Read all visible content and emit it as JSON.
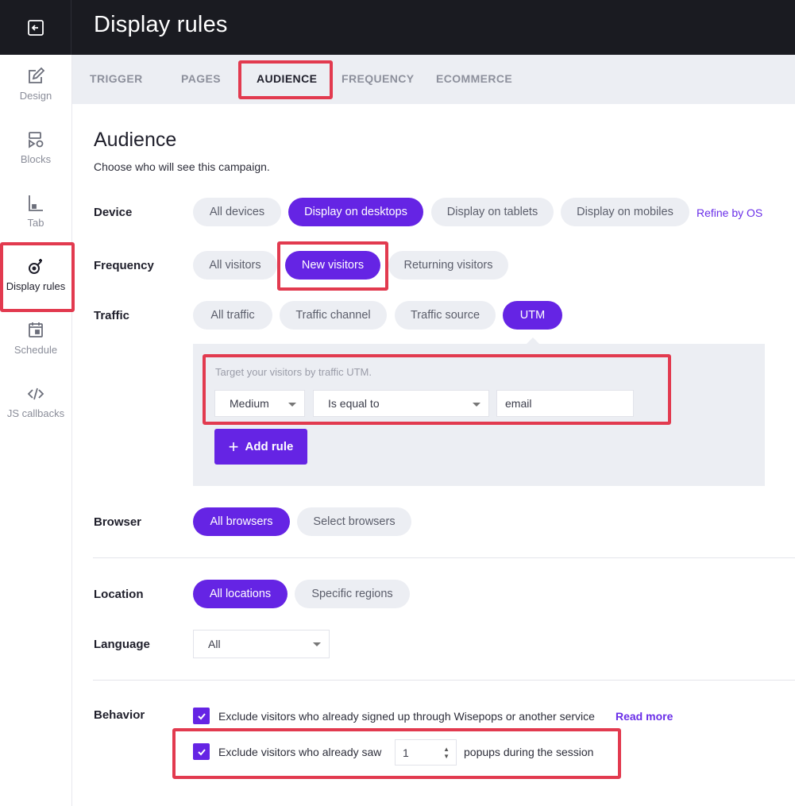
{
  "header": {
    "title": "Display rules",
    "back_icon": "collapse-sidebar-icon"
  },
  "sidebar": {
    "items": [
      {
        "label": "Design",
        "icon": "pencil-square-icon"
      },
      {
        "label": "Blocks",
        "icon": "shapes-icon"
      },
      {
        "label": "Tab",
        "icon": "tab-chart-icon"
      },
      {
        "label": "Display rules",
        "icon": "target-sparkle-icon",
        "active": true
      },
      {
        "label": "Schedule",
        "icon": "calendar-icon"
      },
      {
        "label": "JS callbacks",
        "icon": "code-icon"
      }
    ]
  },
  "tabs": [
    {
      "label": "TRIGGER"
    },
    {
      "label": "PAGES"
    },
    {
      "label": "AUDIENCE",
      "active": true
    },
    {
      "label": "FREQUENCY"
    },
    {
      "label": "ECOMMERCE"
    }
  ],
  "audience": {
    "title": "Audience",
    "subtitle": "Choose who will see this campaign.",
    "device": {
      "label": "Device",
      "options": [
        "All devices",
        "Display on desktops",
        "Display on tablets",
        "Display on mobiles"
      ],
      "selected": "Display on desktops",
      "refine_link": "Refine by OS"
    },
    "frequency": {
      "label": "Frequency",
      "options": [
        "All visitors",
        "New visitors",
        "Returning visitors"
      ],
      "selected": "New visitors"
    },
    "traffic": {
      "label": "Traffic",
      "options": [
        "All traffic",
        "Traffic channel",
        "Traffic source",
        "UTM"
      ],
      "selected": "UTM",
      "utm": {
        "hint": "Target your visitors by traffic UTM.",
        "param": "Medium",
        "operator": "Is equal to",
        "value": "email",
        "add_rule": "Add rule"
      }
    },
    "browser": {
      "label": "Browser",
      "options": [
        "All browsers",
        "Select browsers"
      ],
      "selected": "All browsers"
    },
    "location": {
      "label": "Location",
      "options": [
        "All locations",
        "Specific regions"
      ],
      "selected": "All locations"
    },
    "language": {
      "label": "Language",
      "value": "All"
    },
    "behavior": {
      "label": "Behavior",
      "exclude_signed_up": {
        "text": "Exclude visitors who already signed up through Wisepops or another service",
        "checked": true,
        "read_more": "Read more"
      },
      "exclude_saw": {
        "text_before": "Exclude visitors who already saw",
        "count": "1",
        "text_after": "popups during the session",
        "checked": true
      }
    }
  },
  "colors": {
    "accent": "#6524e4",
    "highlight": "#e23a4f",
    "topbar": "#1a1b21",
    "pill": "#eceef3"
  }
}
